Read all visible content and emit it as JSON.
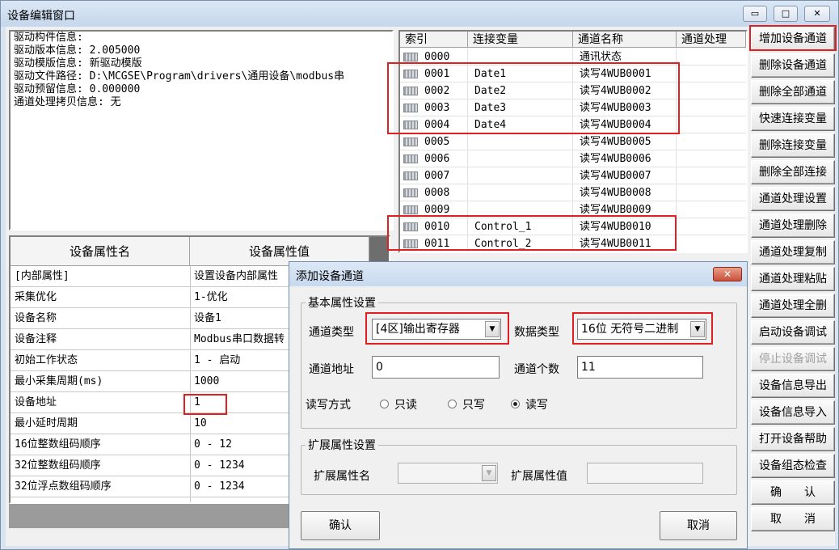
{
  "window": {
    "title": "设备编辑窗口",
    "minimize": "▭",
    "maximize": "□",
    "close": "✕"
  },
  "driver_info": [
    "驱动构件信息:",
    "驱动版本信息: 2.005000",
    "驱动模版信息: 新驱动模版",
    "驱动文件路径: D:\\MCGSE\\Program\\drivers\\通用设备\\modbus串",
    "驱动预留信息: 0.000000",
    "通道处理拷贝信息: 无"
  ],
  "props": {
    "headers": [
      "设备属性名",
      "设备属性值"
    ],
    "rows": [
      [
        "[内部属性]",
        "设置设备内部属性"
      ],
      [
        "采集优化",
        "1-优化"
      ],
      [
        "设备名称",
        "设备1"
      ],
      [
        "设备注释",
        "Modbus串口数据转"
      ],
      [
        "初始工作状态",
        "1 - 启动"
      ],
      [
        "最小采集周期(ms)",
        "1000"
      ],
      [
        "设备地址",
        "1"
      ],
      [
        "最小延时周期",
        "10"
      ],
      [
        "16位整数组码顺序",
        "0 - 12"
      ],
      [
        "32位整数组码顺序",
        "0 - 1234"
      ],
      [
        "32位浮点数组码顺序",
        "0 - 1234"
      ]
    ]
  },
  "channels": {
    "headers": [
      "索引",
      "连接变量",
      "通道名称",
      "通道处理"
    ],
    "rows": [
      [
        "0000",
        "",
        "通讯状态",
        ""
      ],
      [
        "0001",
        "Date1",
        "读写4WUB0001",
        ""
      ],
      [
        "0002",
        "Date2",
        "读写4WUB0002",
        ""
      ],
      [
        "0003",
        "Date3",
        "读写4WUB0003",
        ""
      ],
      [
        "0004",
        "Date4",
        "读写4WUB0004",
        ""
      ],
      [
        "0005",
        "",
        "读写4WUB0005",
        ""
      ],
      [
        "0006",
        "",
        "读写4WUB0006",
        ""
      ],
      [
        "0007",
        "",
        "读写4WUB0007",
        ""
      ],
      [
        "0008",
        "",
        "读写4WUB0008",
        ""
      ],
      [
        "0009",
        "",
        "读写4WUB0009",
        ""
      ],
      [
        "0010",
        "Control_1",
        "读写4WUB0010",
        ""
      ],
      [
        "0011",
        "Control_2",
        "读写4WUB0011",
        ""
      ]
    ]
  },
  "buttons": [
    "增加设备通道",
    "删除设备通道",
    "删除全部通道",
    "快速连接变量",
    "删除连接变量",
    "删除全部连接",
    "通道处理设置",
    "通道处理删除",
    "通道处理复制",
    "通道处理粘贴",
    "通道处理全删",
    "启动设备调试",
    "停止设备调试",
    "设备信息导出",
    "设备信息导入",
    "打开设备帮助",
    "设备组态检查",
    "确　　认",
    "取　　消"
  ],
  "dialog": {
    "title": "添加设备通道",
    "basic_group": "基本属性设置",
    "channel_type_label": "通道类型",
    "channel_type_value": "[4区]输出寄存器",
    "data_type_label": "数据类型",
    "data_type_value": "16位 无符号二进制",
    "address_label": "通道地址",
    "address_value": "0",
    "count_label": "通道个数",
    "count_value": "11",
    "rw_label": "读写方式",
    "rw_options": [
      "只读",
      "只写",
      "读写"
    ],
    "rw_selected": "读写",
    "ext_group": "扩展属性设置",
    "ext_name_label": "扩展属性名",
    "ext_value_label": "扩展属性值",
    "ok": "确认",
    "cancel": "取消",
    "close": "✕"
  },
  "colors": {
    "highlight": "#e02020"
  }
}
